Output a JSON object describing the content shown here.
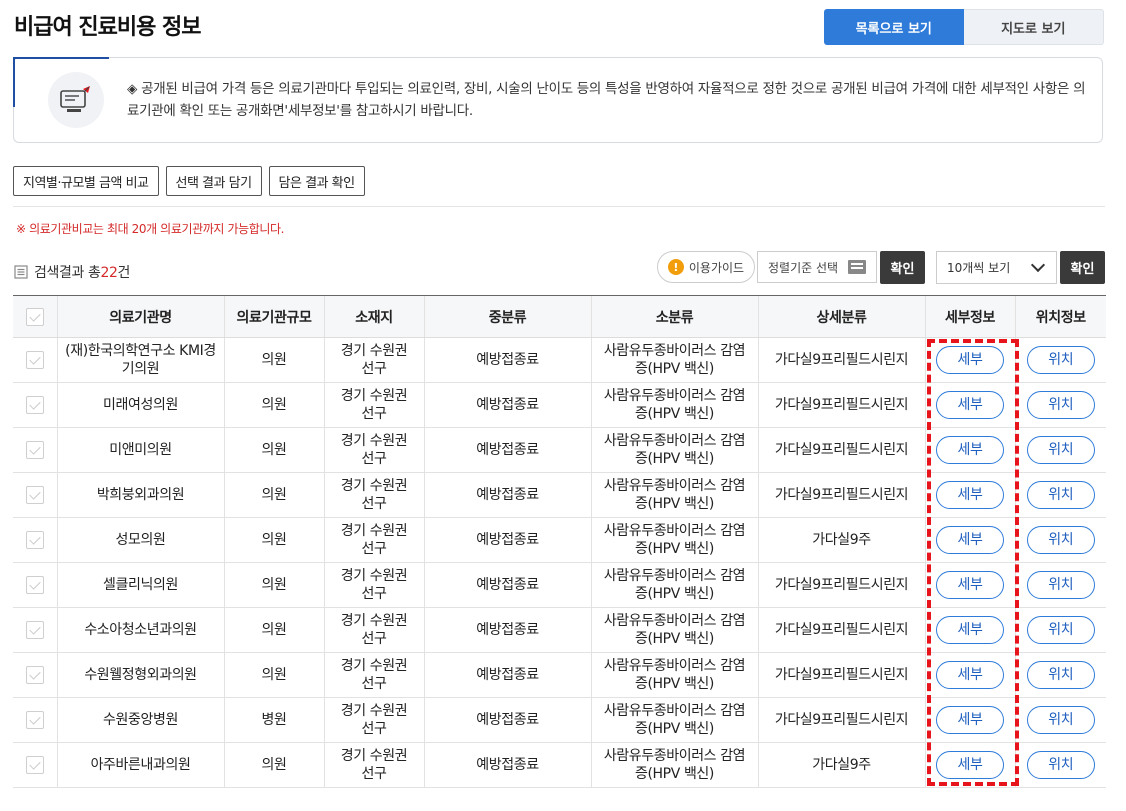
{
  "header": {
    "title": "비급여 진료비용 정보",
    "view_list_label": "목록으로 보기",
    "view_map_label": "지도로 보기"
  },
  "notice": {
    "icon": "price-card-icon",
    "text": "◈ 공개된 비급여 가격 등은 의료기관마다 투입되는 의료인력, 장비, 시술의 난이도 등의 특성을 반영하여 자율적으로 정한 것으로 공개된 비급여 가격에 대한 세부적인 사항은 의료기관에 확인 또는 공개화면'세부정보'를 참고하시기 바랍니다."
  },
  "actions": {
    "compare_label": "지역별·규모별 금액 비교",
    "add_selection_label": "선택 결과 담기",
    "view_saved_label": "담은 결과 확인"
  },
  "warning": "※ 의료기관비교는 최대 20개 의료기관까지 가능합니다.",
  "results": {
    "prefix": "검색결과 총",
    "count": "22",
    "suffix": "건"
  },
  "toolbar": {
    "guide_label": "이용가이드",
    "sort_placeholder": "정렬기준 선택",
    "confirm_label": "확인",
    "page_size_label": "10개씩 보기",
    "confirm2_label": "확인"
  },
  "table": {
    "headers": {
      "name": "의료기관명",
      "scale": "의료기관규모",
      "location": "소재지",
      "mid": "중분류",
      "sub": "소분류",
      "detail": "상세분류",
      "detail_info": "세부정보",
      "location_info": "위치정보"
    },
    "detail_button": "세부",
    "location_button": "위치",
    "rows": [
      {
        "name": "(재)한국의학연구소 KMI경기의원",
        "scale": "의원",
        "location": "경기 수원권선구",
        "mid": "예방접종료",
        "sub": "사람유두종바이러스 감염증(HPV 백신)",
        "detail": "가다실9프리필드시린지"
      },
      {
        "name": "미래여성의원",
        "scale": "의원",
        "location": "경기 수원권선구",
        "mid": "예방접종료",
        "sub": "사람유두종바이러스 감염증(HPV 백신)",
        "detail": "가다실9프리필드시린지"
      },
      {
        "name": "미앤미의원",
        "scale": "의원",
        "location": "경기 수원권선구",
        "mid": "예방접종료",
        "sub": "사람유두종바이러스 감염증(HPV 백신)",
        "detail": "가다실9프리필드시린지"
      },
      {
        "name": "박희붕외과의원",
        "scale": "의원",
        "location": "경기 수원권선구",
        "mid": "예방접종료",
        "sub": "사람유두종바이러스 감염증(HPV 백신)",
        "detail": "가다실9프리필드시린지"
      },
      {
        "name": "성모의원",
        "scale": "의원",
        "location": "경기 수원권선구",
        "mid": "예방접종료",
        "sub": "사람유두종바이러스 감염증(HPV 백신)",
        "detail": "가다실9주"
      },
      {
        "name": "셀클리닉의원",
        "scale": "의원",
        "location": "경기 수원권선구",
        "mid": "예방접종료",
        "sub": "사람유두종바이러스 감염증(HPV 백신)",
        "detail": "가다실9프리필드시린지"
      },
      {
        "name": "수소아청소년과의원",
        "scale": "의원",
        "location": "경기 수원권선구",
        "mid": "예방접종료",
        "sub": "사람유두종바이러스 감염증(HPV 백신)",
        "detail": "가다실9프리필드시린지"
      },
      {
        "name": "수원웰정형외과의원",
        "scale": "의원",
        "location": "경기 수원권선구",
        "mid": "예방접종료",
        "sub": "사람유두종바이러스 감염증(HPV 백신)",
        "detail": "가다실9프리필드시린지"
      },
      {
        "name": "수원중앙병원",
        "scale": "병원",
        "location": "경기 수원권선구",
        "mid": "예방접종료",
        "sub": "사람유두종바이러스 감염증(HPV 백신)",
        "detail": "가다실9프리필드시린지"
      },
      {
        "name": "아주바른내과의원",
        "scale": "의원",
        "location": "경기 수원권선구",
        "mid": "예방접종료",
        "sub": "사람유두종바이러스 감염증(HPV 백신)",
        "detail": "가다실9주"
      }
    ]
  },
  "colors": {
    "primary": "#2f7bd9",
    "accent_red": "#d42a2a",
    "highlight": "#e8141c"
  }
}
